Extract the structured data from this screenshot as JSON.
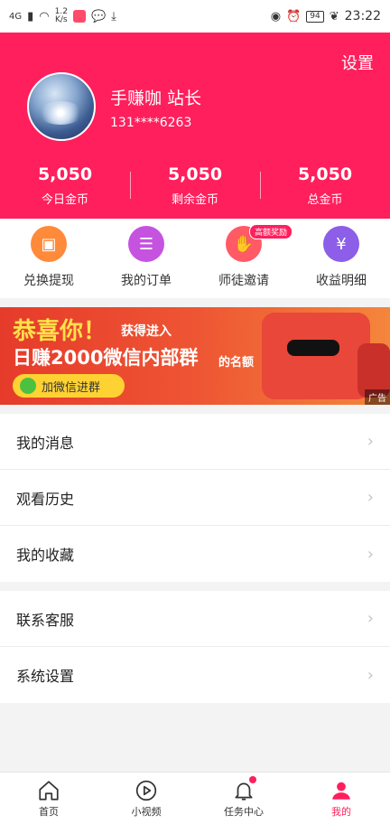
{
  "status_bar": {
    "signal": "4G",
    "speed_value": "1.2",
    "speed_unit": "K/s",
    "battery": "94",
    "time": "23:22"
  },
  "header": {
    "settings_label": "设置",
    "username": "手赚咖 站长",
    "phone": "131****6263",
    "stats": [
      {
        "value": "5,050",
        "label": "今日金币"
      },
      {
        "value": "5,050",
        "label": "剩余金币"
      },
      {
        "value": "5,050",
        "label": "总金币"
      }
    ],
    "accent_color": "#ff1f5c"
  },
  "actions": [
    {
      "label": "兑换提现",
      "icon": "ticket-icon",
      "color": "#ff8a3a"
    },
    {
      "label": "我的订单",
      "icon": "clipboard-icon",
      "color": "#c553e0"
    },
    {
      "label": "师徒邀请",
      "icon": "handshake-icon",
      "color": "#ff5a66",
      "badge": "高额奖励"
    },
    {
      "label": "收益明细",
      "icon": "yuan-doc-icon",
      "color": "#8d5ee8"
    }
  ],
  "banner": {
    "title": "恭喜你！",
    "subtitle": "获得进入",
    "main": "日赚2000微信内部群",
    "tail": "的名额",
    "button": "加微信进群",
    "ad_tag": "广告"
  },
  "menu_group_1": [
    {
      "label": "我的消息"
    },
    {
      "label": "观看历史"
    },
    {
      "label": "我的收藏"
    }
  ],
  "menu_group_2": [
    {
      "label": "联系客服"
    },
    {
      "label": "系统设置"
    }
  ],
  "tabbar": [
    {
      "label": "首页",
      "icon": "home-icon"
    },
    {
      "label": "小视频",
      "icon": "play-circle-icon"
    },
    {
      "label": "任务中心",
      "icon": "bell-icon",
      "dot": true
    },
    {
      "label": "我的",
      "icon": "user-icon",
      "active": true
    }
  ]
}
